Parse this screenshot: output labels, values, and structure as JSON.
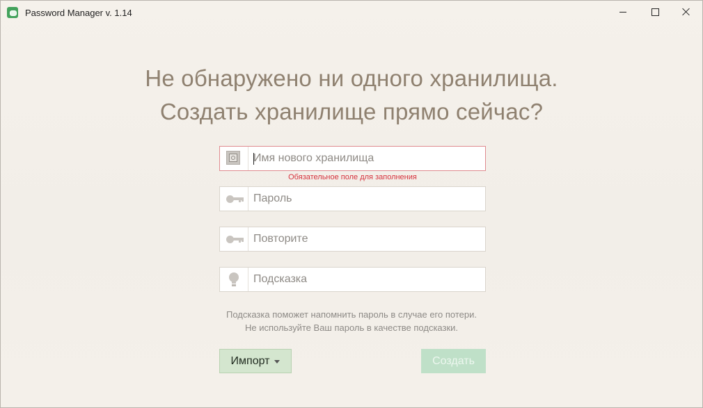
{
  "window": {
    "title": "Password Manager v. 1.14",
    "controls": {
      "minimize": "minimize",
      "maximize": "maximize",
      "close": "close"
    }
  },
  "headline": {
    "line1": "Не обнаружено ни одного хранилища.",
    "line2": "Создать хранилище прямо сейчас?"
  },
  "form": {
    "vault_name": {
      "placeholder": "Имя нового хранилища",
      "value": "",
      "icon": "safe-icon"
    },
    "vault_name_error": "Обязательное поле для заполнения",
    "password": {
      "placeholder": "Пароль",
      "value": "",
      "icon": "key-icon"
    },
    "repeat": {
      "placeholder": "Повторите",
      "value": "",
      "icon": "key-icon"
    },
    "hint": {
      "placeholder": "Подсказка",
      "value": "",
      "icon": "lightbulb-icon"
    }
  },
  "hint_text": {
    "line1": "Подсказка поможет напомнить пароль в случае его потери.",
    "line2": "Не используйте Ваш пароль в качестве подсказки."
  },
  "buttons": {
    "import_label": "Импорт",
    "create_label": "Создать"
  },
  "colors": {
    "background": "#f3efe9",
    "headline": "#8f8170",
    "error": "#d6323d",
    "import_button": "#d4e6cf",
    "create_button": "#bfe0c8",
    "app_icon": "#43a25c"
  }
}
